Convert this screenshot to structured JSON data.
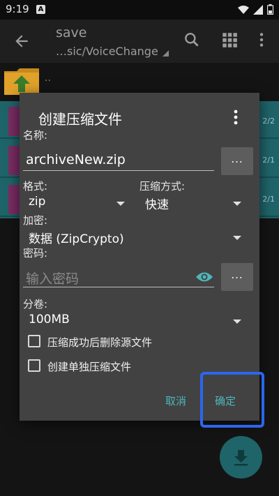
{
  "status_bar": {
    "time": "9:19",
    "notification_badge": "A",
    "icons": [
      "wifi-icon",
      "signal-icon",
      "battery-icon"
    ]
  },
  "app_bar": {
    "title": "save",
    "subtitle": "…sic/VoiceChange"
  },
  "list": {
    "parent_label": "..",
    "rows": [
      {
        "count": "2/2"
      },
      {
        "count": "2/1"
      },
      {
        "count": "2/1"
      }
    ]
  },
  "dialog": {
    "title": "创建压缩文件",
    "name_label": "名称:",
    "name_value": "archiveNew.zip",
    "more_label": "...",
    "format_label": "格式:",
    "format_value": "zip",
    "compress_label": "压缩方式:",
    "compress_value": "快速",
    "encrypt_label": "加密:",
    "encrypt_value": "数据 (ZipCrypto)",
    "password_label": "密码:",
    "password_placeholder": "输入密码",
    "split_label": "分卷:",
    "split_value": "100MB",
    "checkbox_delete_source": {
      "label": "压缩成功后删除源文件",
      "checked": false
    },
    "checkbox_separate": {
      "label": "创建单独压缩文件",
      "checked": false
    },
    "cancel_label": "取消",
    "ok_label": "确定"
  },
  "colors": {
    "accent": "#4fb6b9",
    "highlight": "#2b66f0",
    "teal": "#1f6469",
    "dialog_bg": "#424242"
  }
}
